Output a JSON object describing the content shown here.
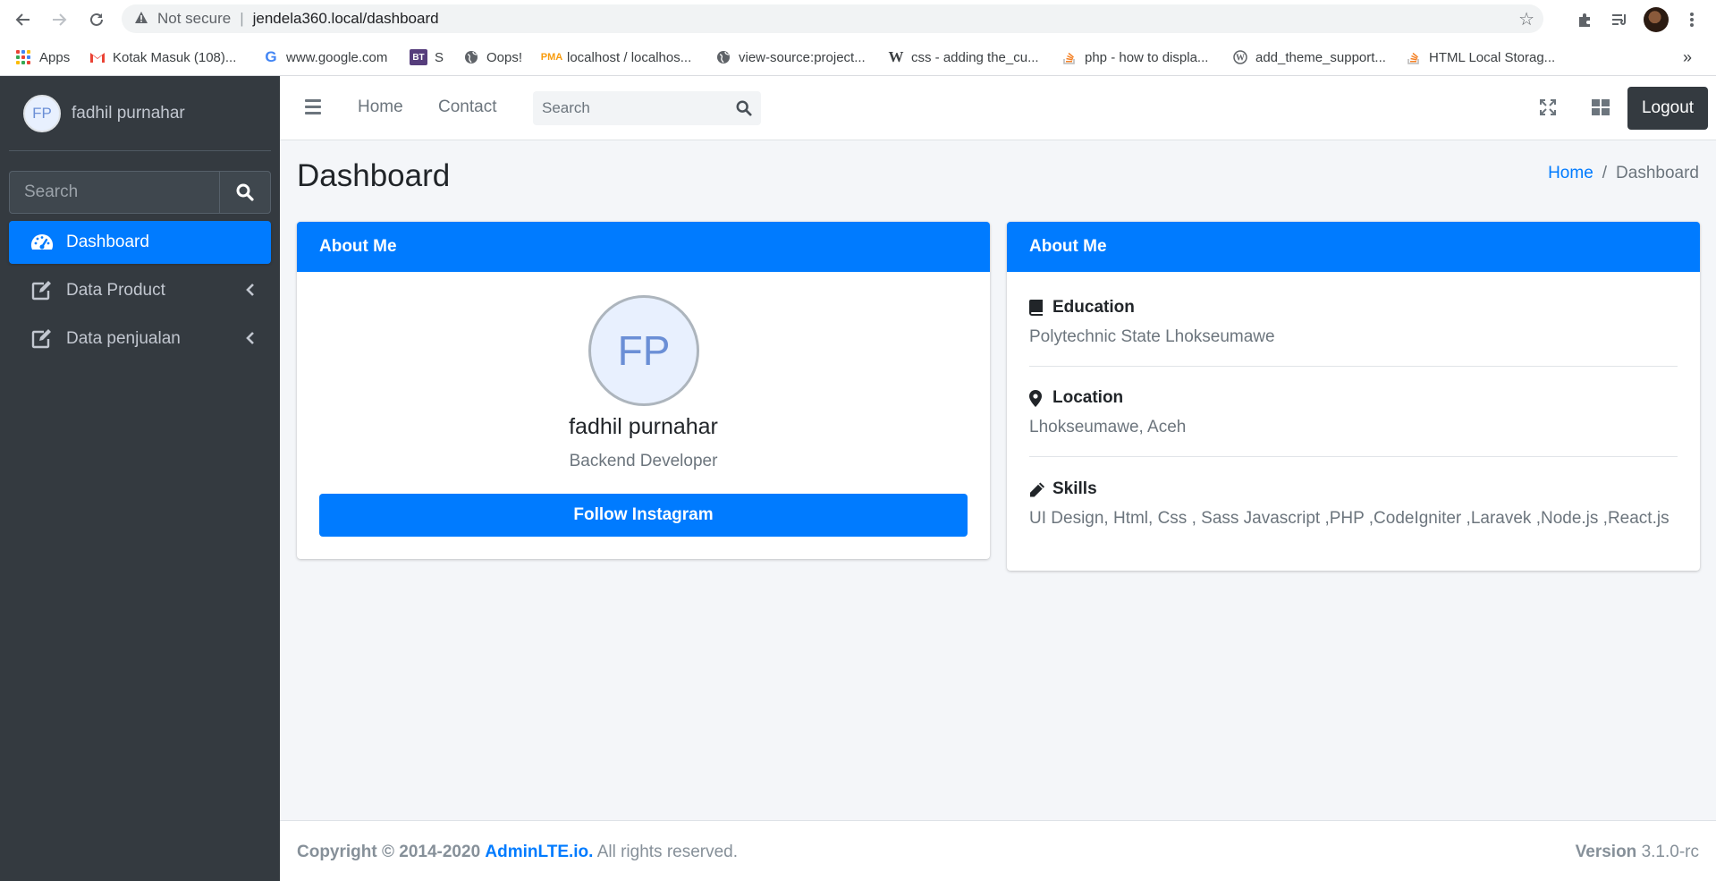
{
  "browser": {
    "security_text": "Not secure",
    "url": "jendela360.local/dashboard",
    "bookmarks": [
      "Apps",
      "Kotak Masuk (108)...",
      "www.google.com",
      "S",
      "Oops!",
      "localhost / localhos...",
      "view-source:project...",
      "css - adding the_cu...",
      "php - how to displa...",
      "add_theme_support...",
      "HTML Local Storag..."
    ],
    "bookmark_icons": [
      "apps-grid-icon",
      "gmail-icon",
      "google-icon",
      "bt-icon",
      "globe-icon",
      "phpmyadmin-icon",
      "globe-icon",
      "wikipedia-icon",
      "stackoverflow-icon",
      "wordpress-icon",
      "stackoverflow-icon"
    ],
    "more_bookmarks": "»"
  },
  "sidebar": {
    "user": {
      "initials": "FP",
      "name": "fadhil purnahar"
    },
    "search_placeholder": "Search",
    "items": [
      {
        "label": "Dashboard",
        "icon": "tachometer-icon",
        "active": true
      },
      {
        "label": "Data Product",
        "icon": "edit-icon",
        "chevron": "‹"
      },
      {
        "label": "Data penjualan",
        "icon": "edit-icon",
        "chevron": "‹"
      }
    ]
  },
  "topnav": {
    "links": [
      "Home",
      "Contact"
    ],
    "search_placeholder": "Search",
    "logout": "Logout"
  },
  "header": {
    "title": "Dashboard",
    "breadcrumb": {
      "home": "Home",
      "separator": "/",
      "current": "Dashboard"
    }
  },
  "profile_card": {
    "title": "About Me",
    "initials": "FP",
    "name": "fadhil purnahar",
    "role": "Backend Developer",
    "button": "Follow Instagram"
  },
  "about_card": {
    "title": "About Me",
    "sections": [
      {
        "title": "Education",
        "icon": "book-icon",
        "text": "Polytechnic State Lhokseumawe"
      },
      {
        "title": "Location",
        "icon": "map-marker-icon",
        "text": "Lhokseumawe, Aceh"
      },
      {
        "title": "Skills",
        "icon": "pencil-icon",
        "text": "UI Design, Html, Css , Sass Javascript ,PHP ,CodeIgniter ,Laravek ,Node.js ,React.js"
      }
    ]
  },
  "footer": {
    "copyright": "Copyright © 2014-2020",
    "brand": "AdminLTE.io.",
    "rights": "All rights reserved.",
    "version_label": "Version",
    "version": "3.1.0-rc"
  },
  "colors": {
    "primary": "#007bff",
    "sidebar": "#343a40",
    "background": "#f4f6f9"
  }
}
